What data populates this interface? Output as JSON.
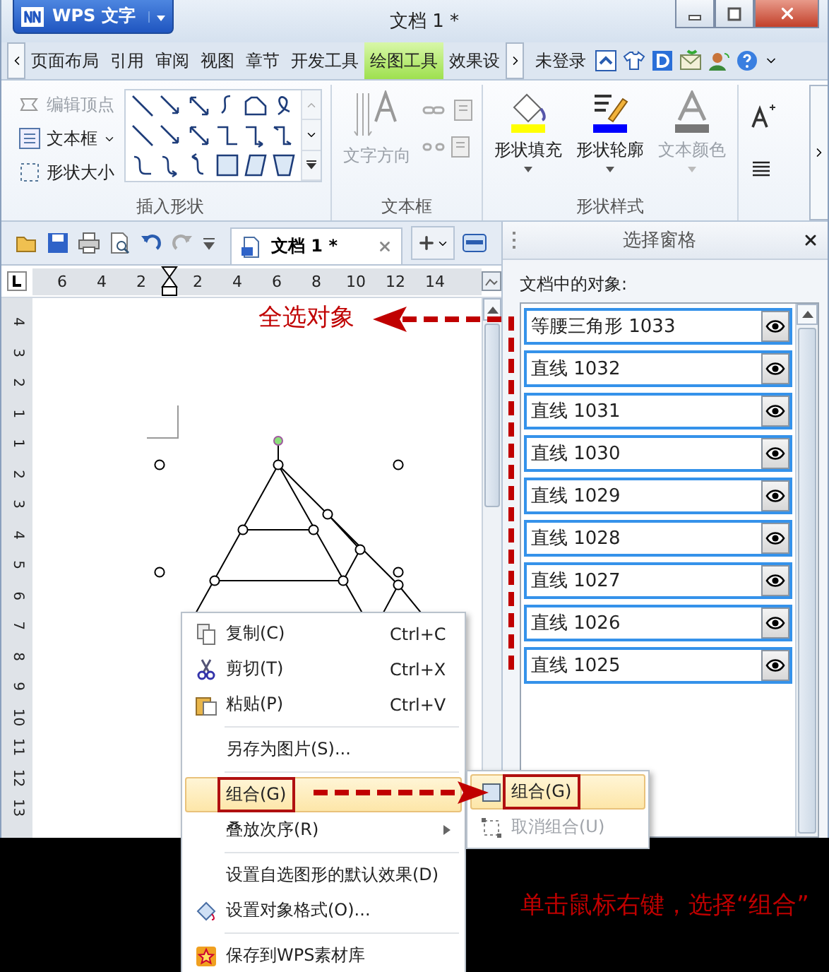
{
  "window": {
    "app_button": "WPS 文字",
    "title": "文档 1 *"
  },
  "menu_tabs": [
    {
      "label": "页面布局",
      "selected": false
    },
    {
      "label": "引用",
      "selected": false
    },
    {
      "label": "审阅",
      "selected": false
    },
    {
      "label": "视图",
      "selected": false
    },
    {
      "label": "章节",
      "selected": false
    },
    {
      "label": "开发工具",
      "selected": false
    },
    {
      "label": "绘图工具",
      "selected": true
    },
    {
      "label": "效果设",
      "selected": false
    }
  ],
  "account": "未登录",
  "ribbon": {
    "small_buttons": [
      {
        "label": "编辑顶点",
        "disabled": true
      },
      {
        "label": "文本框",
        "disabled": false
      },
      {
        "label": "形状大小",
        "disabled": false
      }
    ],
    "text_direction": "文字方向",
    "style_buttons": [
      {
        "label": "形状填充",
        "disabled": false
      },
      {
        "label": "形状轮廓",
        "disabled": false
      },
      {
        "label": "文本颜色",
        "disabled": true
      }
    ],
    "groups": [
      "插入形状",
      "文本框",
      "形状样式"
    ]
  },
  "doc_tab": "文档 1 *",
  "ruler": [
    "6",
    "4",
    "2",
    "2",
    "4",
    "6",
    "8",
    "10",
    "12",
    "14"
  ],
  "vertical_ruler": [
    "4",
    "3",
    "2",
    "1",
    "1",
    "2",
    "3",
    "4",
    "5",
    "6",
    "7",
    "8",
    "9",
    "10",
    "11",
    "12",
    "13"
  ],
  "pane": {
    "title": "选择窗格",
    "label": "文档中的对象:",
    "objects": [
      {
        "name": "等腰三角形 1033",
        "selected": true
      },
      {
        "name": "直线 1032",
        "selected": true
      },
      {
        "name": "直线 1031",
        "selected": true
      },
      {
        "name": "直线 1030",
        "selected": true
      },
      {
        "name": "直线 1029",
        "selected": true
      },
      {
        "name": "直线 1028",
        "selected": true
      },
      {
        "name": "直线 1027",
        "selected": true
      },
      {
        "name": "直线 1026",
        "selected": true
      },
      {
        "name": "直线 1025",
        "selected": true
      }
    ]
  },
  "context_menu": [
    {
      "kind": "item",
      "label": "复制(C)",
      "shortcut": "Ctrl+C",
      "selected": false
    },
    {
      "kind": "item",
      "label": "剪切(T)",
      "shortcut": "Ctrl+X",
      "selected": false
    },
    {
      "kind": "item",
      "label": "粘贴(P)",
      "shortcut": "Ctrl+V",
      "selected": false
    },
    {
      "kind": "separator"
    },
    {
      "kind": "item",
      "label": "另存为图片(S)...",
      "selected": false
    },
    {
      "kind": "separator"
    },
    {
      "kind": "item",
      "label": "组合(G)",
      "selected": true
    },
    {
      "kind": "submenu",
      "label": "叠放次序(R)",
      "selected": false
    },
    {
      "kind": "separator"
    },
    {
      "kind": "item",
      "label": "设置自选图形的默认效果(D)",
      "selected": false
    },
    {
      "kind": "item",
      "label": "设置对象格式(O)...",
      "selected": false
    },
    {
      "kind": "separator"
    },
    {
      "kind": "item",
      "label": "保存到WPS素材库",
      "selected": false
    }
  ],
  "submenu": [
    {
      "label": "组合(G)",
      "selected": true,
      "disabled": false
    },
    {
      "label": "取消组合(U)",
      "selected": false,
      "disabled": true
    }
  ],
  "annotations": {
    "select_all": "全选对象",
    "instruction": "单击鼠标右键，选择“组合”"
  }
}
